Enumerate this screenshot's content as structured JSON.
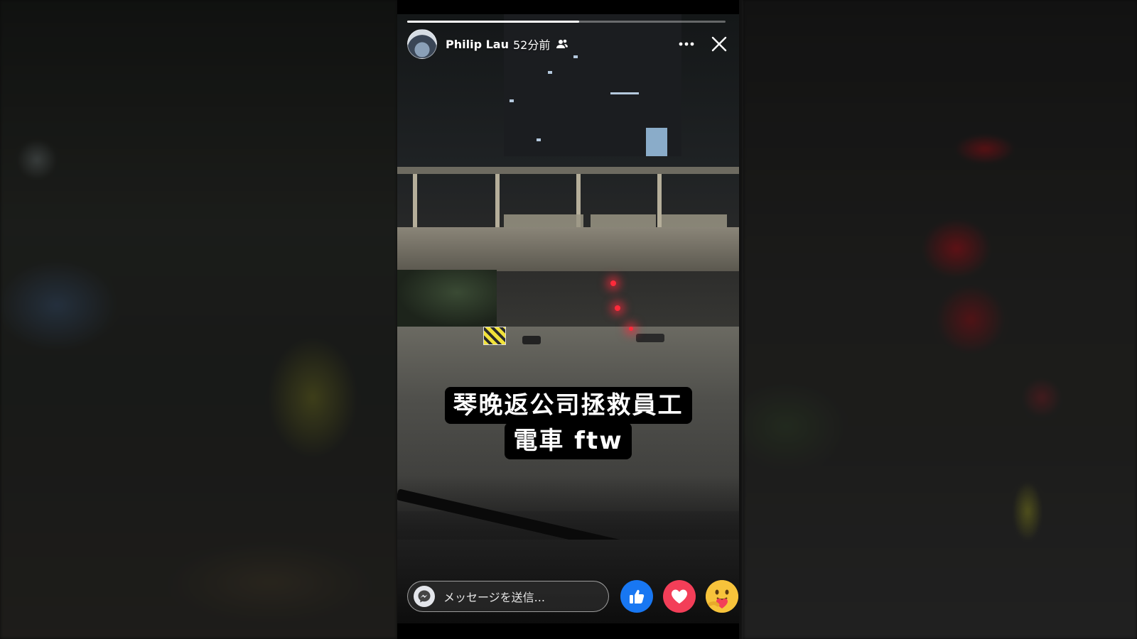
{
  "story": {
    "username": "Philip Lau",
    "timestamp": "52分前",
    "progress_fraction": 0.54,
    "caption_line1": "琴晚返公司拯救員工",
    "caption_line2": "電車 ftw"
  },
  "reply": {
    "placeholder": "メッセージを送信..."
  },
  "reactions": [
    "like",
    "love",
    "care"
  ],
  "icons": {
    "friends": "friends-icon",
    "more": "more-icon",
    "close": "close-icon",
    "messenger": "messenger-icon"
  },
  "colors": {
    "like": "#1877f2",
    "love": "#f33e58",
    "care": "#f7c33b"
  }
}
